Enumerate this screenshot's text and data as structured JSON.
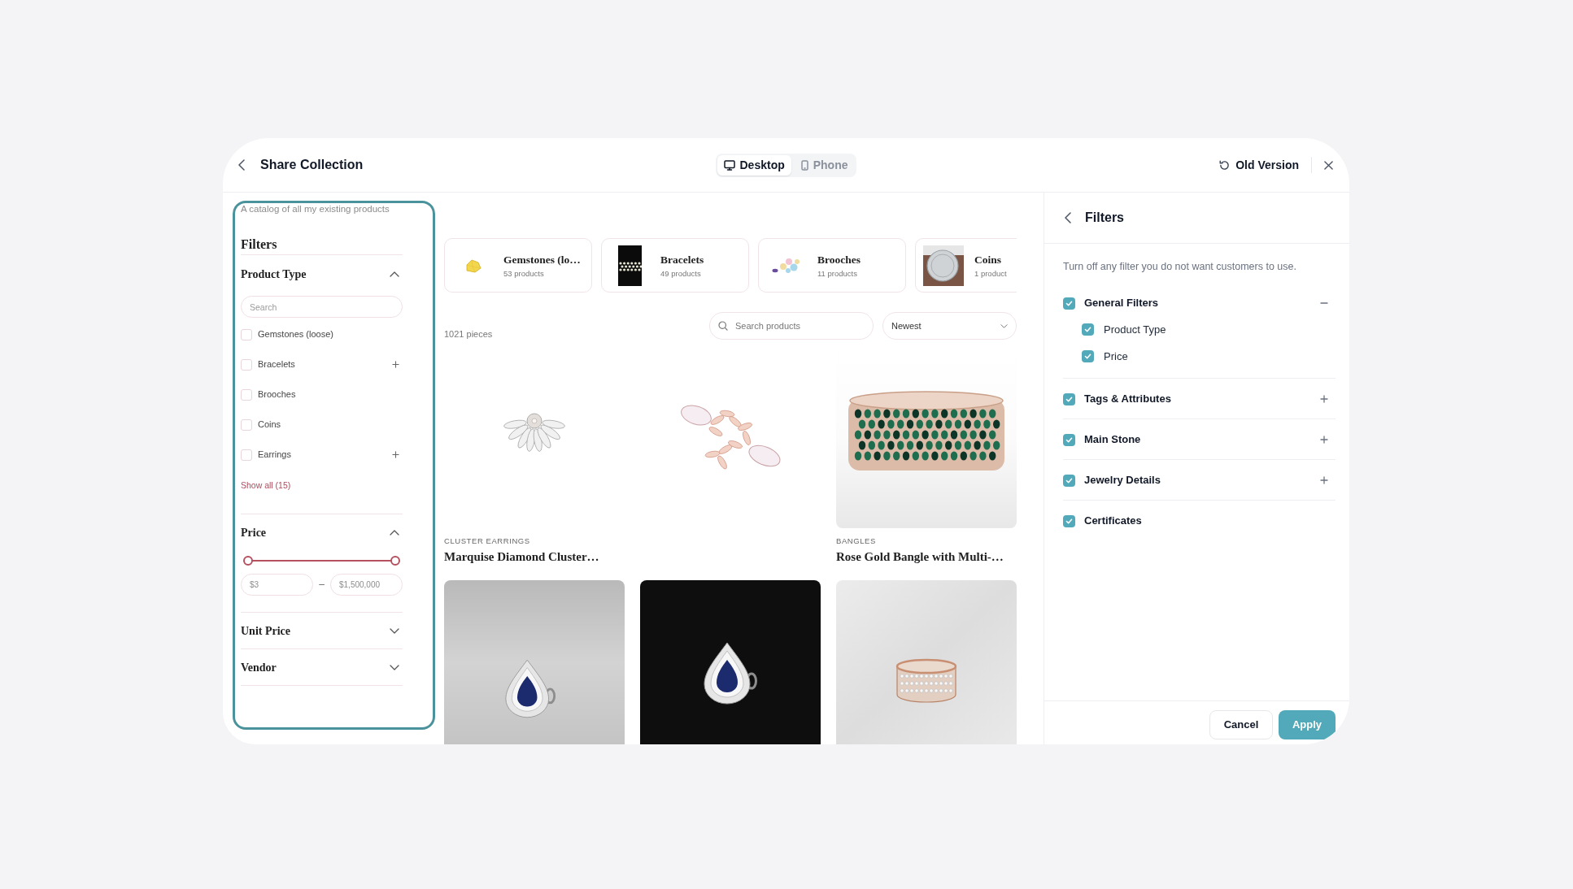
{
  "window": {
    "title": "Share Collection"
  },
  "view_toggle": [
    {
      "label": "Desktop",
      "selected": true
    },
    {
      "label": "Phone",
      "selected": false
    }
  ],
  "old_version_button": {
    "label": "Old Version"
  },
  "preview": {
    "description": "A catalog of all my existing products",
    "filters_title": "Filters",
    "sections": [
      {
        "kind": "checklist",
        "title": "Product Type",
        "expanded": true,
        "search": {
          "placeholder": "Search"
        },
        "options": [
          {
            "label": "Gemstones (loose)",
            "checked": false,
            "has_children": false
          },
          {
            "label": "Bracelets",
            "checked": false,
            "has_children": true
          },
          {
            "label": "Brooches",
            "checked": false,
            "has_children": false
          },
          {
            "label": "Coins",
            "checked": false,
            "has_children": false
          },
          {
            "label": "Earrings",
            "checked": false,
            "has_children": true
          }
        ],
        "show_all": "Show all (15)"
      },
      {
        "kind": "range",
        "title": "Price",
        "expanded": true,
        "handles": [
          {
            "level": 0
          },
          {
            "level": 1
          }
        ],
        "min_field": {
          "placeholder": "$3"
        },
        "separator": "–",
        "max_field": {
          "placeholder": "$1,500,000"
        }
      },
      {
        "title": "Unit Price",
        "expanded": false
      },
      {
        "title": "Vendor",
        "expanded": false
      }
    ],
    "categories": [
      {
        "name": "Gemstones (lo…",
        "count": "53 products"
      },
      {
        "name": "Bracelets",
        "count": "49 products"
      },
      {
        "name": "Brooches",
        "count": "11 products"
      },
      {
        "name": "Coins",
        "count": "1 product"
      }
    ],
    "result_count": "1021 pieces",
    "search": {
      "placeholder": "Search products"
    },
    "sort": {
      "value": "Newest"
    },
    "products": [
      {
        "kind": "cutout",
        "category": "CLUSTER EARRINGS",
        "title": "Marquise Diamond Cluster…"
      },
      {
        "kind": "cutout"
      },
      {
        "kind": "photo",
        "category": "BANGLES",
        "title": "Rose Gold Bangle with Multi-…"
      },
      {
        "kind": "photo"
      },
      {
        "kind": "photo"
      },
      {
        "kind": "photo"
      }
    ]
  },
  "filters_panel": {
    "title": "Filters",
    "description": "Turn off any filter you do not want customers to use.",
    "groups": [
      {
        "label": "General Filters",
        "checked": true,
        "expanded": true,
        "children": [
          {
            "label": "Product Type",
            "checked": true
          },
          {
            "label": "Price",
            "checked": true
          }
        ]
      },
      {
        "label": "Tags & Attributes",
        "checked": true,
        "expanded": false
      },
      {
        "label": "Main Stone",
        "checked": true,
        "expanded": false
      },
      {
        "label": "Jewelry Details",
        "checked": true,
        "expanded": false
      },
      {
        "label": "Certificates",
        "checked": true
      }
    ],
    "buttons": [
      {
        "label": "Cancel",
        "kind": "secondary"
      },
      {
        "label": "Apply",
        "kind": "primary"
      }
    ]
  }
}
